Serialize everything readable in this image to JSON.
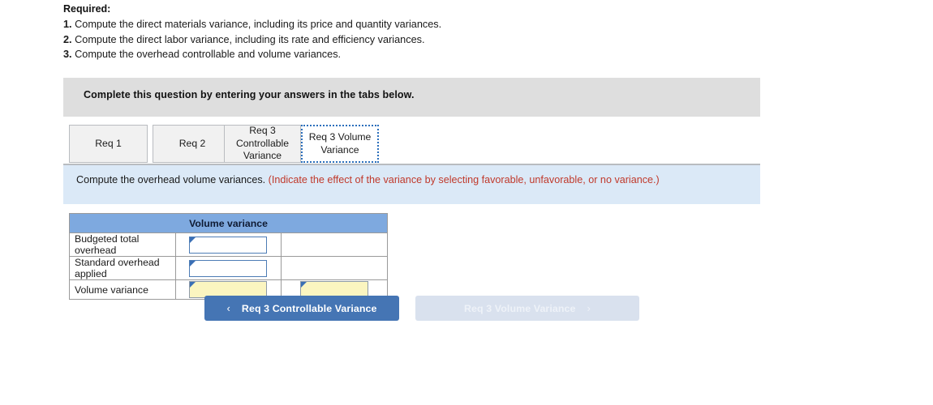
{
  "required": {
    "heading": "Required:",
    "items": [
      {
        "num": "1.",
        "text": "Compute the direct materials variance, including its price and quantity variances."
      },
      {
        "num": "2.",
        "text": "Compute the direct labor variance, including its rate and efficiency variances."
      },
      {
        "num": "3.",
        "text": "Compute the overhead controllable and volume variances."
      }
    ]
  },
  "banner": {
    "complete_text": "Complete this question by entering your answers in the tabs below."
  },
  "tabs": [
    {
      "label": "Req 1",
      "active": false
    },
    {
      "label": "Req 2",
      "active": false
    },
    {
      "label": "Req 3 Controllable Variance",
      "active": false
    },
    {
      "label": "Req 3 Volume Variance",
      "active": true
    }
  ],
  "question": {
    "prompt": "Compute the overhead volume variances.",
    "note": "(Indicate the effect of the variance by selecting favorable, unfavorable, or no variance.)"
  },
  "table": {
    "header": "Volume variance",
    "rows": [
      {
        "label": "Budgeted total overhead",
        "value": "",
        "effect": "",
        "highlight": false,
        "has_effect_box": false
      },
      {
        "label": "Standard overhead applied",
        "value": "",
        "effect": "",
        "highlight": false,
        "has_effect_box": false
      },
      {
        "label": "Volume variance",
        "value": "",
        "effect": "",
        "highlight": true,
        "has_effect_box": true
      }
    ]
  },
  "nav": {
    "prev_label": "Req 3 Controllable Variance",
    "prev_icon": "chevron-left-icon",
    "prev_glyph": "‹",
    "next_label": "Req 3 Volume Variance",
    "next_icon": "chevron-right-icon",
    "next_glyph": "›"
  },
  "colors": {
    "grey_banner": "#dedede",
    "blue_banner": "#dbe9f7",
    "table_header": "#7ea9df",
    "input_yellow": "#fbf5c0",
    "primary_button": "#4575b4",
    "disabled_button": "#d9e1ee",
    "note_red": "#c0392b"
  }
}
